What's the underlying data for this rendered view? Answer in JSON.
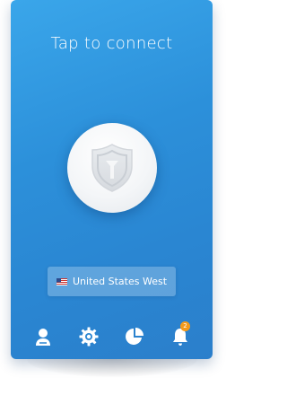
{
  "screen": {
    "title": "Tap to connect"
  },
  "connect_button": {
    "icon": "shield-icon"
  },
  "location": {
    "label": "United States West",
    "flag": "us-flag-icon"
  },
  "nav": {
    "items": [
      {
        "icon": "account-icon"
      },
      {
        "icon": "settings-icon"
      },
      {
        "icon": "stats-icon"
      },
      {
        "icon": "notifications-icon",
        "badge": "2"
      }
    ]
  },
  "colors": {
    "background_top": "#3aa6ea",
    "background_bottom": "#2b7fcb",
    "badge": "#f39a1c"
  }
}
